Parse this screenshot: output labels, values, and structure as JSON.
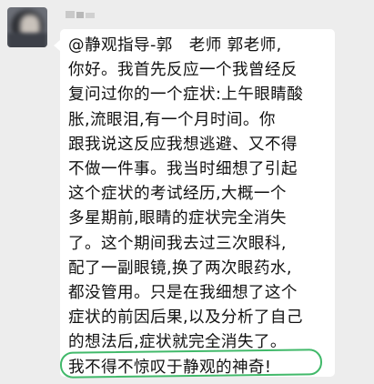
{
  "chat": {
    "sender_name": "",
    "message_lines": [
      "@静观指导-郭　老师 郭老师,",
      "你好。我首先反应一个我曾经反",
      "复问过你的一个症状:上午眼睛酸",
      "胀,流眼泪,有一个月时间。你",
      "跟我说这反应我想逃避、又不得",
      "不做一件事。我当时细想了引起",
      "这个症状的考试经历,大概一个",
      "多星期前,眼睛的症状完全消失",
      "了。这个期间我去过三次眼科,",
      "配了一副眼镜,换了两次眼药水,",
      "都没管用。只是在我细想了这个",
      "症状的前因后果,以及分析了自己",
      "的想法后,症状就完全消失了。",
      "我不得不惊叹于静观的神奇!"
    ]
  },
  "colors": {
    "background": "#ededed",
    "bubble": "#ffffff",
    "text": "#111111",
    "highlight_circle": "#41b96a"
  }
}
